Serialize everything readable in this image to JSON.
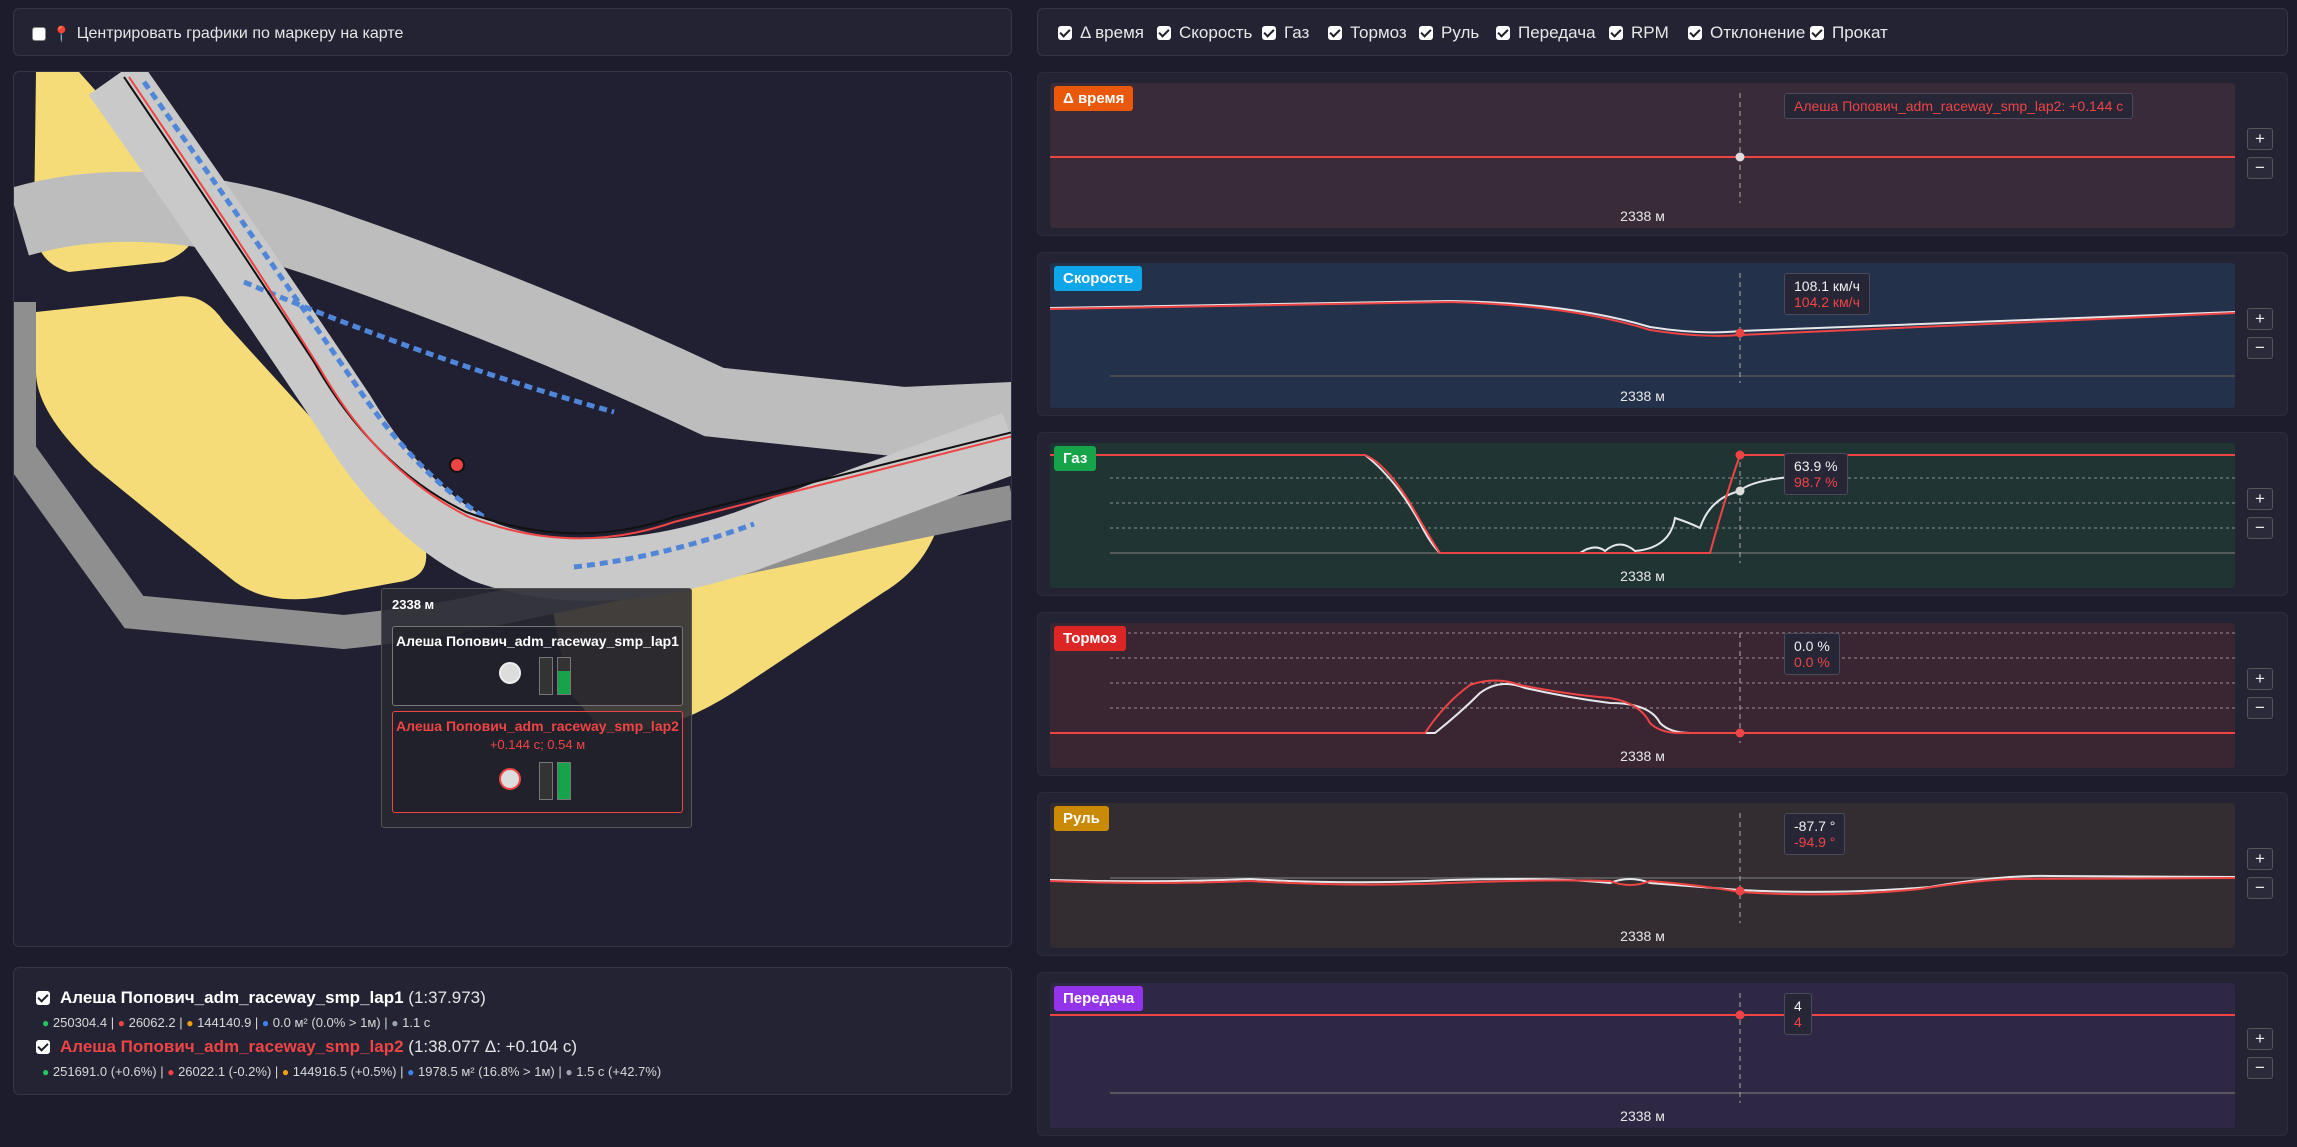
{
  "top_left": {
    "center_label": "Центрировать графики по маркеру на карте",
    "center_checked": false
  },
  "toggles": [
    {
      "label": "Δ время",
      "checked": true
    },
    {
      "label": "Скорость",
      "checked": true
    },
    {
      "label": "Газ",
      "checked": true
    },
    {
      "label": "Тормоз",
      "checked": true
    },
    {
      "label": "Руль",
      "checked": true
    },
    {
      "label": "Передача",
      "checked": true
    },
    {
      "label": "RPM",
      "checked": true
    },
    {
      "label": "Отклонение",
      "checked": true
    },
    {
      "label": "Прокат",
      "checked": true
    }
  ],
  "map_popup": {
    "distance": "2338 м",
    "lap1_name": "Алеша Попович_adm_raceway_smp_lap1",
    "lap2_name": "Алеша Попович_adm_raceway_smp_lap2",
    "lap2_delta": "+0.144 с; 0.54 м"
  },
  "laps": [
    {
      "name": "Алеша Попович_adm_raceway_smp_lap1",
      "time": "(1:37.973)",
      "checked": true,
      "color": "#ffffff",
      "s1": "250304.4",
      "s2": "26062.2",
      "s3": "144140.9",
      "s4": "0.0 м² (0.0% > 1м)",
      "s5": "1.1 с"
    },
    {
      "name": "Алеша Попович_adm_raceway_smp_lap2",
      "time": "(1:38.077 Δ: +0.104 с)",
      "checked": true,
      "color": "#ef4444",
      "s1": "251691.0 (+0.6%)",
      "s2": "26022.1 (-0.2%)",
      "s3": "144916.5 (+0.5%)",
      "s4": "1978.5 м² (16.8% > 1м)",
      "s5": "1.5 с (+42.7%)"
    }
  ],
  "charts": {
    "delta": {
      "title": "Δ время",
      "color": "#ea580c",
      "tip": "Алеша Попович_adm_raceway_smp_lap2: +0.144 с",
      "distance": "2338 м"
    },
    "speed": {
      "title": "Скорость",
      "color": "#0ea5e9",
      "tip1": "108.1 км/ч",
      "tip2": "104.2 км/ч",
      "distance": "2338 м"
    },
    "throttle": {
      "title": "Газ",
      "color": "#16a34a",
      "tip1": "63.9 %",
      "tip2": "98.7 %",
      "distance": "2338 м"
    },
    "brake": {
      "title": "Тормоз",
      "color": "#dc2626",
      "tip1": "0.0 %",
      "tip2": "0.0 %",
      "distance": "2338 м"
    },
    "steer": {
      "title": "Руль",
      "color": "#ca8a04",
      "tip1": "-87.7 °",
      "tip2": "-94.9 °",
      "distance": "2338 м"
    },
    "gear": {
      "title": "Передача",
      "color": "#9333ea",
      "tip1": "4",
      "tip2": "4",
      "distance": "2338 м"
    }
  },
  "zoom": {
    "plus": "+",
    "minus": "−"
  },
  "colors": {
    "lap1": "#ffffff",
    "lap2": "#ef4444",
    "sand": "#f5dc78",
    "track": "#cfcfcf"
  }
}
